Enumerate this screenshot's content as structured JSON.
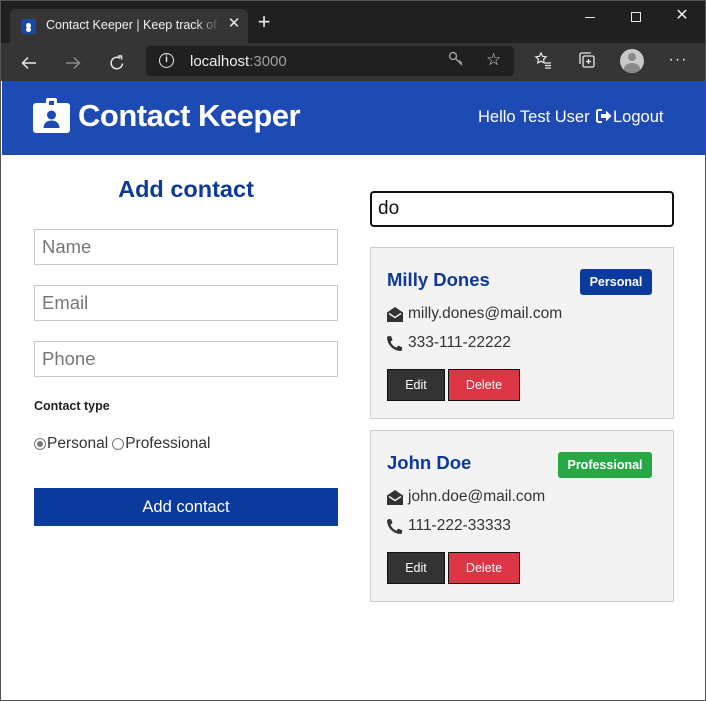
{
  "browser": {
    "tab_title": "Contact Keeper | Keep track of your contacts",
    "url_host": "localhost",
    "url_port": ":3000"
  },
  "navbar": {
    "brand": "Contact Keeper",
    "greeting": "Hello Test User",
    "logout": "Logout",
    "color": "#1e4bb3"
  },
  "form": {
    "title": "Add contact",
    "name_placeholder": "Name",
    "email_placeholder": "Email",
    "phone_placeholder": "Phone",
    "type_label": "Contact type",
    "type_options": [
      "Personal",
      "Professional"
    ],
    "selected_type": "Personal",
    "submit": "Add contact"
  },
  "filter": {
    "value": "do"
  },
  "contacts": [
    {
      "name": "Milly Dones",
      "type": "Personal",
      "type_color": "#0b3a9d",
      "email": "milly.dones@mail.com",
      "phone": "333-111-22222",
      "edit": "Edit",
      "delete": "Delete"
    },
    {
      "name": "John Doe",
      "type": "Professional",
      "type_color": "#28a745",
      "email": "john.doe@mail.com",
      "phone": "111-222-33333",
      "edit": "Edit",
      "delete": "Delete"
    }
  ],
  "icons": [
    "id-badge-icon",
    "logout-icon",
    "envelope-open-icon",
    "phone-icon"
  ]
}
